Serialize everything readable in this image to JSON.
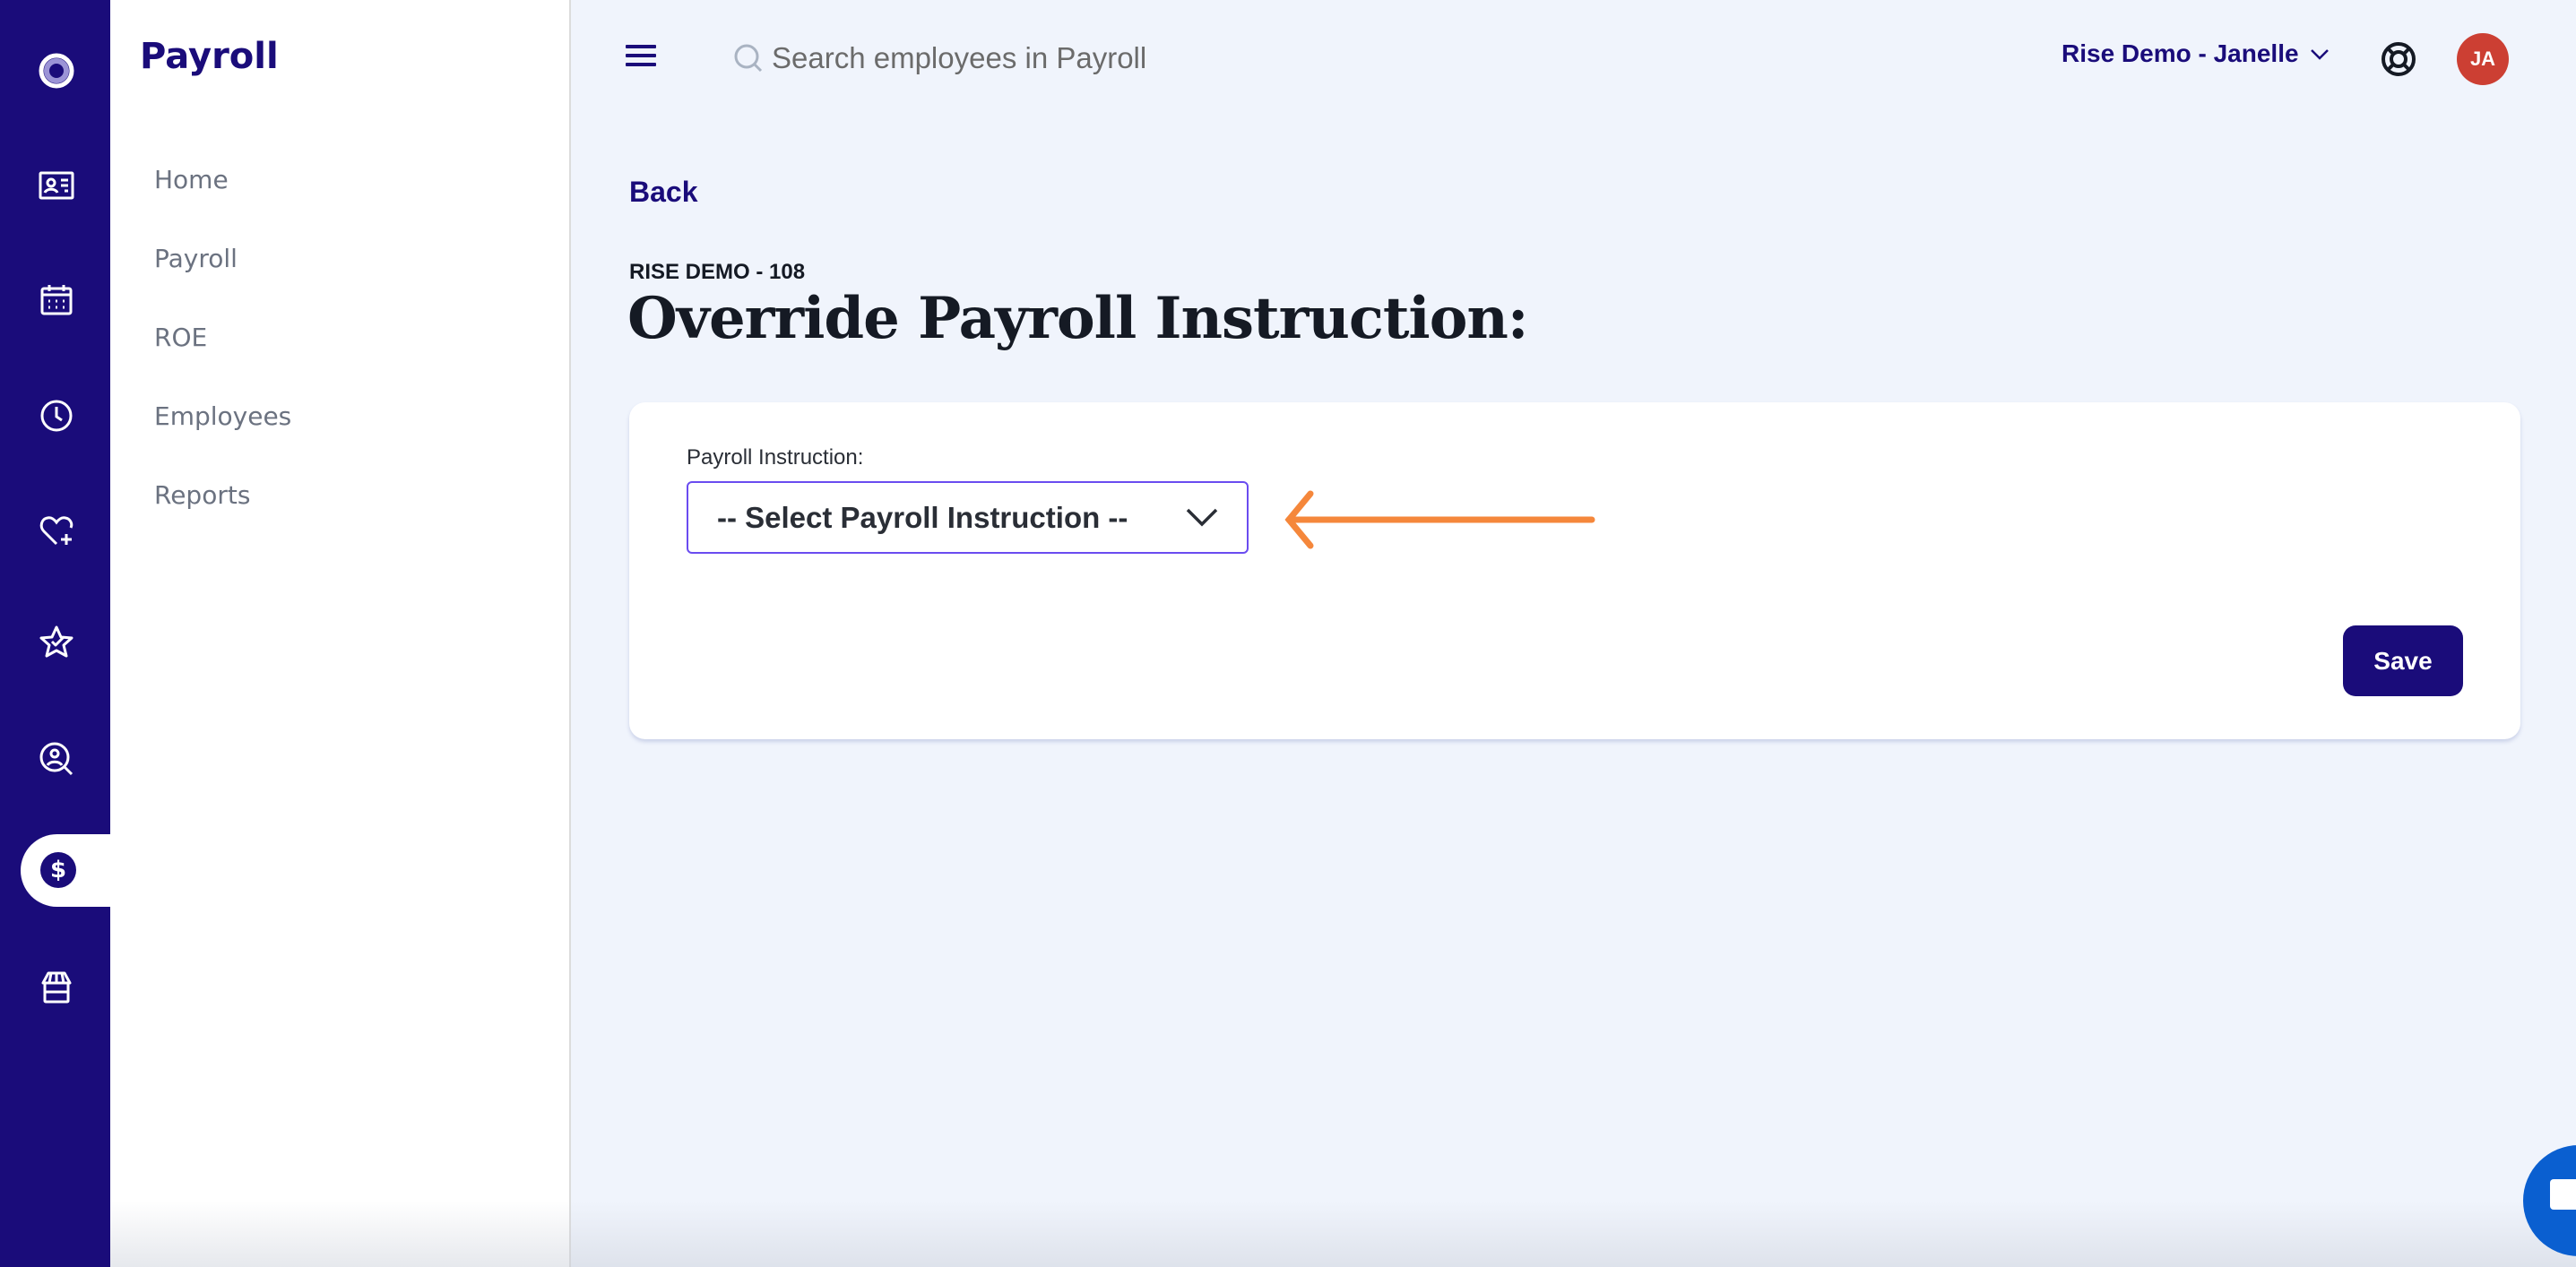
{
  "rail": {
    "items": [
      {
        "name": "logo",
        "icon": "ring-logo-icon"
      },
      {
        "name": "people-directory",
        "icon": "id-card-icon"
      },
      {
        "name": "calendar",
        "icon": "calendar-icon"
      },
      {
        "name": "time",
        "icon": "clock-icon"
      },
      {
        "name": "benefits",
        "icon": "heart-plus-icon"
      },
      {
        "name": "recognition",
        "icon": "star-check-icon"
      },
      {
        "name": "recruiting",
        "icon": "user-search-icon"
      },
      {
        "name": "payroll",
        "icon": "dollar-icon",
        "active": true
      },
      {
        "name": "store",
        "icon": "storefront-icon"
      }
    ],
    "active_glyph": "$"
  },
  "subnav": {
    "title": "Payroll",
    "items": [
      {
        "label": "Home"
      },
      {
        "label": "Payroll"
      },
      {
        "label": "ROE"
      },
      {
        "label": "Employees"
      },
      {
        "label": "Reports"
      }
    ]
  },
  "topbar": {
    "search_placeholder": "Search employees in Payroll",
    "account_label": "Rise Demo - Janelle",
    "avatar_initials": "JA",
    "avatar_color": "#cc3f33"
  },
  "page": {
    "back_label": "Back",
    "eyebrow": "RISE DEMO - 108",
    "title": "Override Payroll Instruction:"
  },
  "form": {
    "field_label": "Payroll Instruction:",
    "select_value": "-- Select Payroll Instruction --",
    "save_label": "Save"
  },
  "colors": {
    "brand": "#1a0c7a",
    "annotation": "#f5873b",
    "focus": "#6a4cf0",
    "chat": "#0a5fd0"
  }
}
